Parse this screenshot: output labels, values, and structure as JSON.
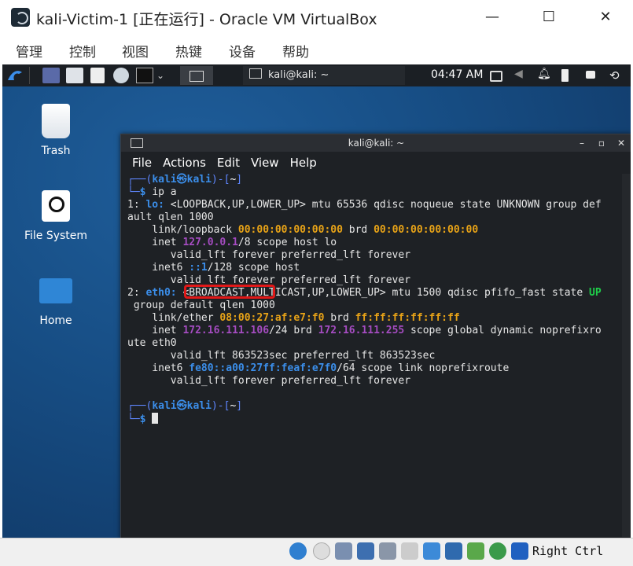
{
  "window": {
    "title": "kali-Victim-1 [正在运行] - Oracle VM VirtualBox",
    "minimize": "—",
    "maximize": "☐",
    "close": "✕"
  },
  "menubar": {
    "items": [
      "管理",
      "控制",
      "视图",
      "热键",
      "设备",
      "帮助"
    ]
  },
  "panel": {
    "tab_label": "kali@kali: ~",
    "clock": "04:47 AM"
  },
  "desktop": {
    "icons": [
      "Trash",
      "File System",
      "Home"
    ]
  },
  "terminal": {
    "title": "kali@kali: ~",
    "controls": [
      "–",
      "▫",
      "✕"
    ],
    "menu": [
      "File",
      "Actions",
      "Edit",
      "View",
      "Help"
    ],
    "prompt_user": "kali",
    "prompt_host": "kali",
    "prompt_dir": "~",
    "command": "ip a",
    "output": {
      "lo_header_a": "1: ",
      "lo_name": "lo:",
      "lo_header_b": " <LOOPBACK,UP,LOWER_UP> mtu 65536 qdisc noqueue state UNKNOWN group def",
      "lo_header_c": "ault qlen 1000",
      "lo_link_a": "    link/loopback ",
      "lo_mac": "00:00:00:00:00:00",
      "lo_link_b": " brd ",
      "lo_brd": "00:00:00:00:00:00",
      "lo_inet_a": "    inet ",
      "lo_ip": "127.0.0.1",
      "lo_inet_b": "/8 scope host lo",
      "lo_valid1": "       valid_lft forever preferred_lft forever",
      "lo_inet6_a": "    inet6 ",
      "lo_ip6": "::1",
      "lo_inet6_b": "/128 scope host",
      "lo_valid2": "       valid_lft forever preferred_lft forever",
      "eth_header_a": "2: ",
      "eth_name": "eth0:",
      "eth_header_b": " <BROADCAST,MULTICAST,UP,LOWER_UP> mtu 1500 qdisc pfifo_fast state ",
      "eth_state": "UP",
      "eth_header_c": " group default qlen 1000",
      "eth_link_a": "    link/ether ",
      "eth_mac": "08:00:27:af:e7:f0",
      "eth_link_b": " brd ",
      "eth_brd": "ff:ff:ff:ff:ff:ff",
      "eth_inet_a": "    inet ",
      "eth_ip": "172.16.111.106",
      "eth_inet_b": "/24 brd ",
      "eth_bcast": "172.16.111.255",
      "eth_inet_c": " scope global dynamic noprefixro",
      "eth_inet_d": "ute eth0",
      "eth_valid1": "       valid_lft 863523sec preferred_lft 863523sec",
      "eth_inet6_a": "    inet6 ",
      "eth_ip6": "fe80::a00:27ff:feaf:e7f0",
      "eth_inet6_b": "/64 scope link noprefixroute",
      "eth_valid2": "       valid_lft forever preferred_lft forever"
    }
  },
  "statusbar": {
    "host_key": "Right Ctrl"
  },
  "colors": {
    "accent_blue": "#3b8eea",
    "mac_orange": "#e8a317",
    "ip_purple": "#a54cc1",
    "highlight_red": "#e01818",
    "state_green": "#1fcf4a"
  }
}
